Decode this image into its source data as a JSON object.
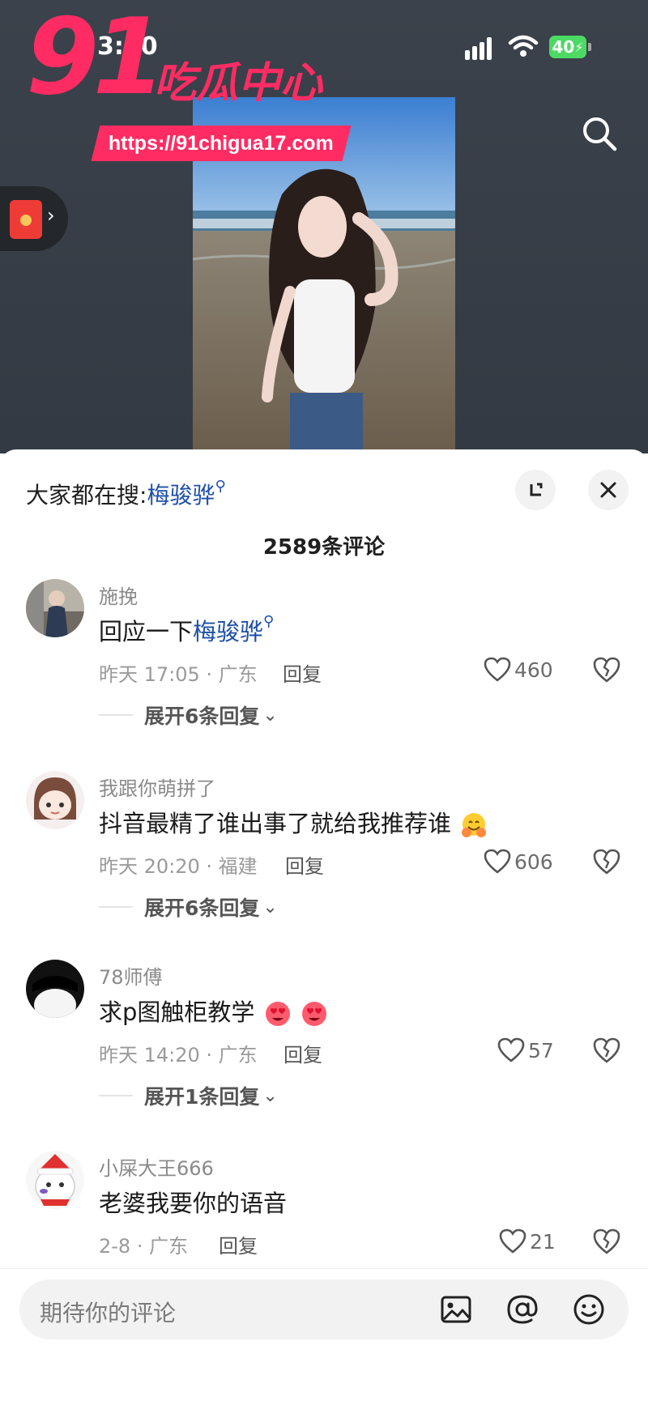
{
  "status_bar": {
    "time": "3:10",
    "battery": "40"
  },
  "watermark": {
    "brand_number": "91",
    "brand_name": "吃瓜中心",
    "url": "https://91chigua17.com"
  },
  "top_bar": {
    "search_icon": "search-icon",
    "red_packet_icon": "red-envelope-icon"
  },
  "sheet": {
    "hot_search_label": "大家都在搜:",
    "hot_search_keyword": "梅骏骅",
    "comment_count": "2589条评论",
    "expand_icon": "expand-icon",
    "close_icon": "close-icon"
  },
  "comments": [
    {
      "username": "施挽",
      "content_prefix": "回应一下",
      "content_keyword": "梅骏骅",
      "time_location": "昨天 17:05 · 广东",
      "reply_label": "回复",
      "likes": "460",
      "expand_replies": "展开6条回复"
    },
    {
      "username": "我跟你萌拼了",
      "content": "抖音最精了谁出事了就给我推荐谁",
      "emoji": "hugging-face-emoji",
      "time_location": "昨天 20:20 · 福建",
      "reply_label": "回复",
      "likes": "606",
      "expand_replies": "展开6条回复"
    },
    {
      "username": "78师傅",
      "content": "求p图触柜教学",
      "emoji": "heart-eyes-emoji",
      "time_location": "昨天 14:20 · 广东",
      "reply_label": "回复",
      "likes": "57",
      "expand_replies": "展开1条回复"
    },
    {
      "username": "小屎大王666",
      "content": "老婆我要你的语音",
      "time_location": "2-8 · 广东",
      "reply_label": "回复",
      "likes": "21"
    }
  ],
  "input_bar": {
    "placeholder": "期待你的评论",
    "icons": [
      "image-icon",
      "at-icon",
      "emoji-icon"
    ]
  },
  "colors": {
    "accent_pink": "#ff2c63",
    "keyword_blue": "#1e4fa8",
    "top_bg": "#3b424b"
  }
}
